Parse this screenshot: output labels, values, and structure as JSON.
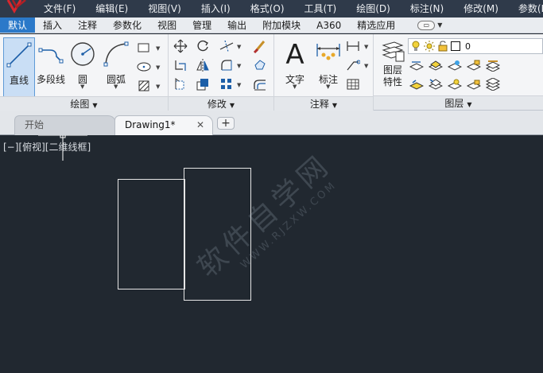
{
  "menu": {
    "items": [
      "文件(F)",
      "编辑(E)",
      "视图(V)",
      "插入(I)",
      "格式(O)",
      "工具(T)",
      "绘图(D)",
      "标注(N)",
      "修改(M)",
      "参数(P)"
    ]
  },
  "ribbon_tabs": {
    "items": [
      "默认",
      "插入",
      "注释",
      "参数化",
      "视图",
      "管理",
      "输出",
      "附加模块",
      "A360",
      "精选应用"
    ],
    "active_index": 0
  },
  "panels": {
    "draw": {
      "title": "绘图",
      "line_label": "直线",
      "polyline_label": "多段线",
      "circle_label": "圆",
      "arc_label": "圆弧"
    },
    "modify": {
      "title": "修改"
    },
    "annotation": {
      "title": "注释",
      "text_label": "文字",
      "dimension_label": "标注"
    },
    "layers": {
      "title": "图层",
      "properties_label_line1": "图层",
      "properties_label_line2": "特性",
      "current_layer": "0"
    }
  },
  "file_tabs": {
    "start_label": "开始",
    "drawing_label": "Drawing1*",
    "close_symbol": "✕",
    "add_symbol": "+"
  },
  "canvas": {
    "view_label": "[−][俯视][二维线框]",
    "watermark": "软件自学网",
    "watermark_sub": "WWW.RJZXW.COM"
  },
  "colors": {
    "menubar": "#2f3a4a",
    "active_tab": "#2b79c9",
    "canvas": "#212830"
  }
}
